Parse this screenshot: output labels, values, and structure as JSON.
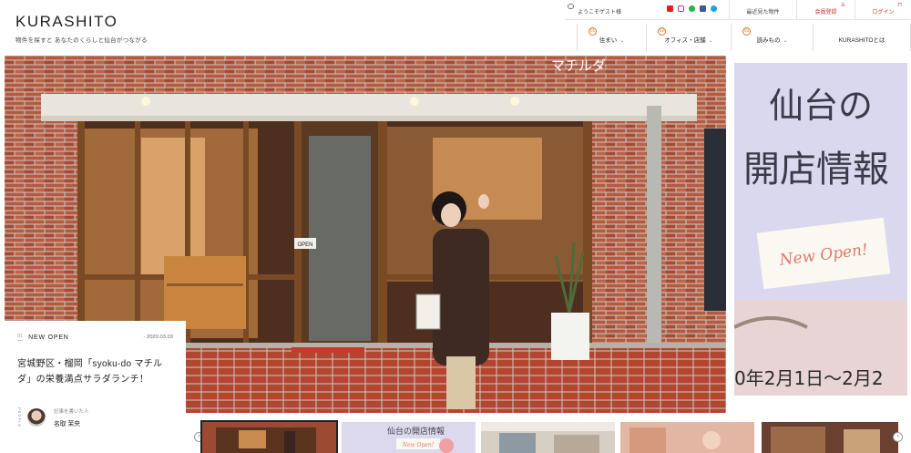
{
  "header": {
    "logo": "KURASHITO",
    "tagline": "物件を探すと あなたのくらしと仙台がつながる"
  },
  "topbar": {
    "welcome": "ようこそゲスト様",
    "recent": "最近見た物件",
    "member": "会員登録",
    "login": "ログイン"
  },
  "nav": [
    {
      "num": "01",
      "label": "住まい"
    },
    {
      "num": "02",
      "label": "オフィス・店舗"
    },
    {
      "num": "03",
      "label": "読みもの"
    },
    {
      "label": "KURASHITOとは"
    }
  ],
  "hero": {
    "shop_sign": "マチルダ",
    "door_sign": "OPEN"
  },
  "side_banner": {
    "line1": "仙台の",
    "line2": "開店情報",
    "badge": "New Open!",
    "date_text": "0年2月1日～2月2"
  },
  "article": {
    "index": "01",
    "category": "NEW OPEN",
    "date": "- 2020.03.03",
    "title": "宮城野区・榴岡「syoku-do マチルダ」の栄養満点サラダランチ！",
    "people_label": "PEOPLE",
    "author_caption": "記事を書いた人",
    "author_name": "名取 茉央"
  },
  "thumbs": {
    "prev": "‹",
    "next": "›",
    "badge": "New Open!",
    "text": "仙台の開店情報"
  },
  "colors": {
    "accent": "#e07a2e",
    "member_red": "#c0392b",
    "brick": "#b5523a",
    "banner_bg": "#d9d7ee"
  },
  "icons": [
    "chat-icon",
    "youtube-icon",
    "instagram-icon",
    "line-icon",
    "facebook-icon",
    "twitter-icon",
    "chevron-down-icon"
  ]
}
